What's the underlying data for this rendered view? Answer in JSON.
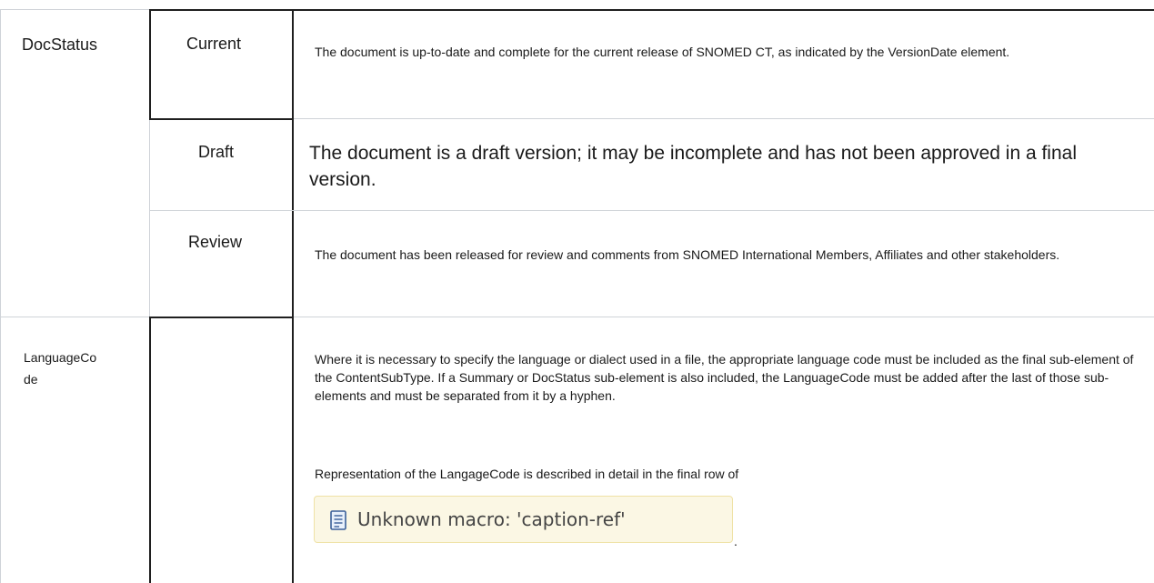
{
  "rows": {
    "docstatus": {
      "term": "DocStatus",
      "values": [
        {
          "label": "Current",
          "description": "The document is up-to-date and complete for the current release of SNOMED CT, as indicated by the VersionDate element."
        },
        {
          "label": "Draft",
          "description": "The document is a draft version; it may be incomplete and has not been approved in a final version."
        },
        {
          "label": "Review",
          "description": "The document has been released for review and comments from SNOMED International Members, Affiliates and other stakeholders."
        }
      ]
    },
    "languagecode": {
      "term_line1": "LanguageCo",
      "term_line2": "de",
      "value": "",
      "description": "Where it is necessary to specify the language or dialect used in a file, the appropriate language code must be included as the final sub-element of the ContentSubType. If a Summary or DocStatus sub-element is also included, the LanguageCode must be added after the last of those sub-elements and must be separated from it by a hyphen.",
      "representation": "Representation of the LangageCode is described in detail in the final row of",
      "macro": {
        "icon": "document-macro-icon",
        "text": "Unknown macro: 'caption-ref'"
      },
      "trailing": "."
    }
  }
}
